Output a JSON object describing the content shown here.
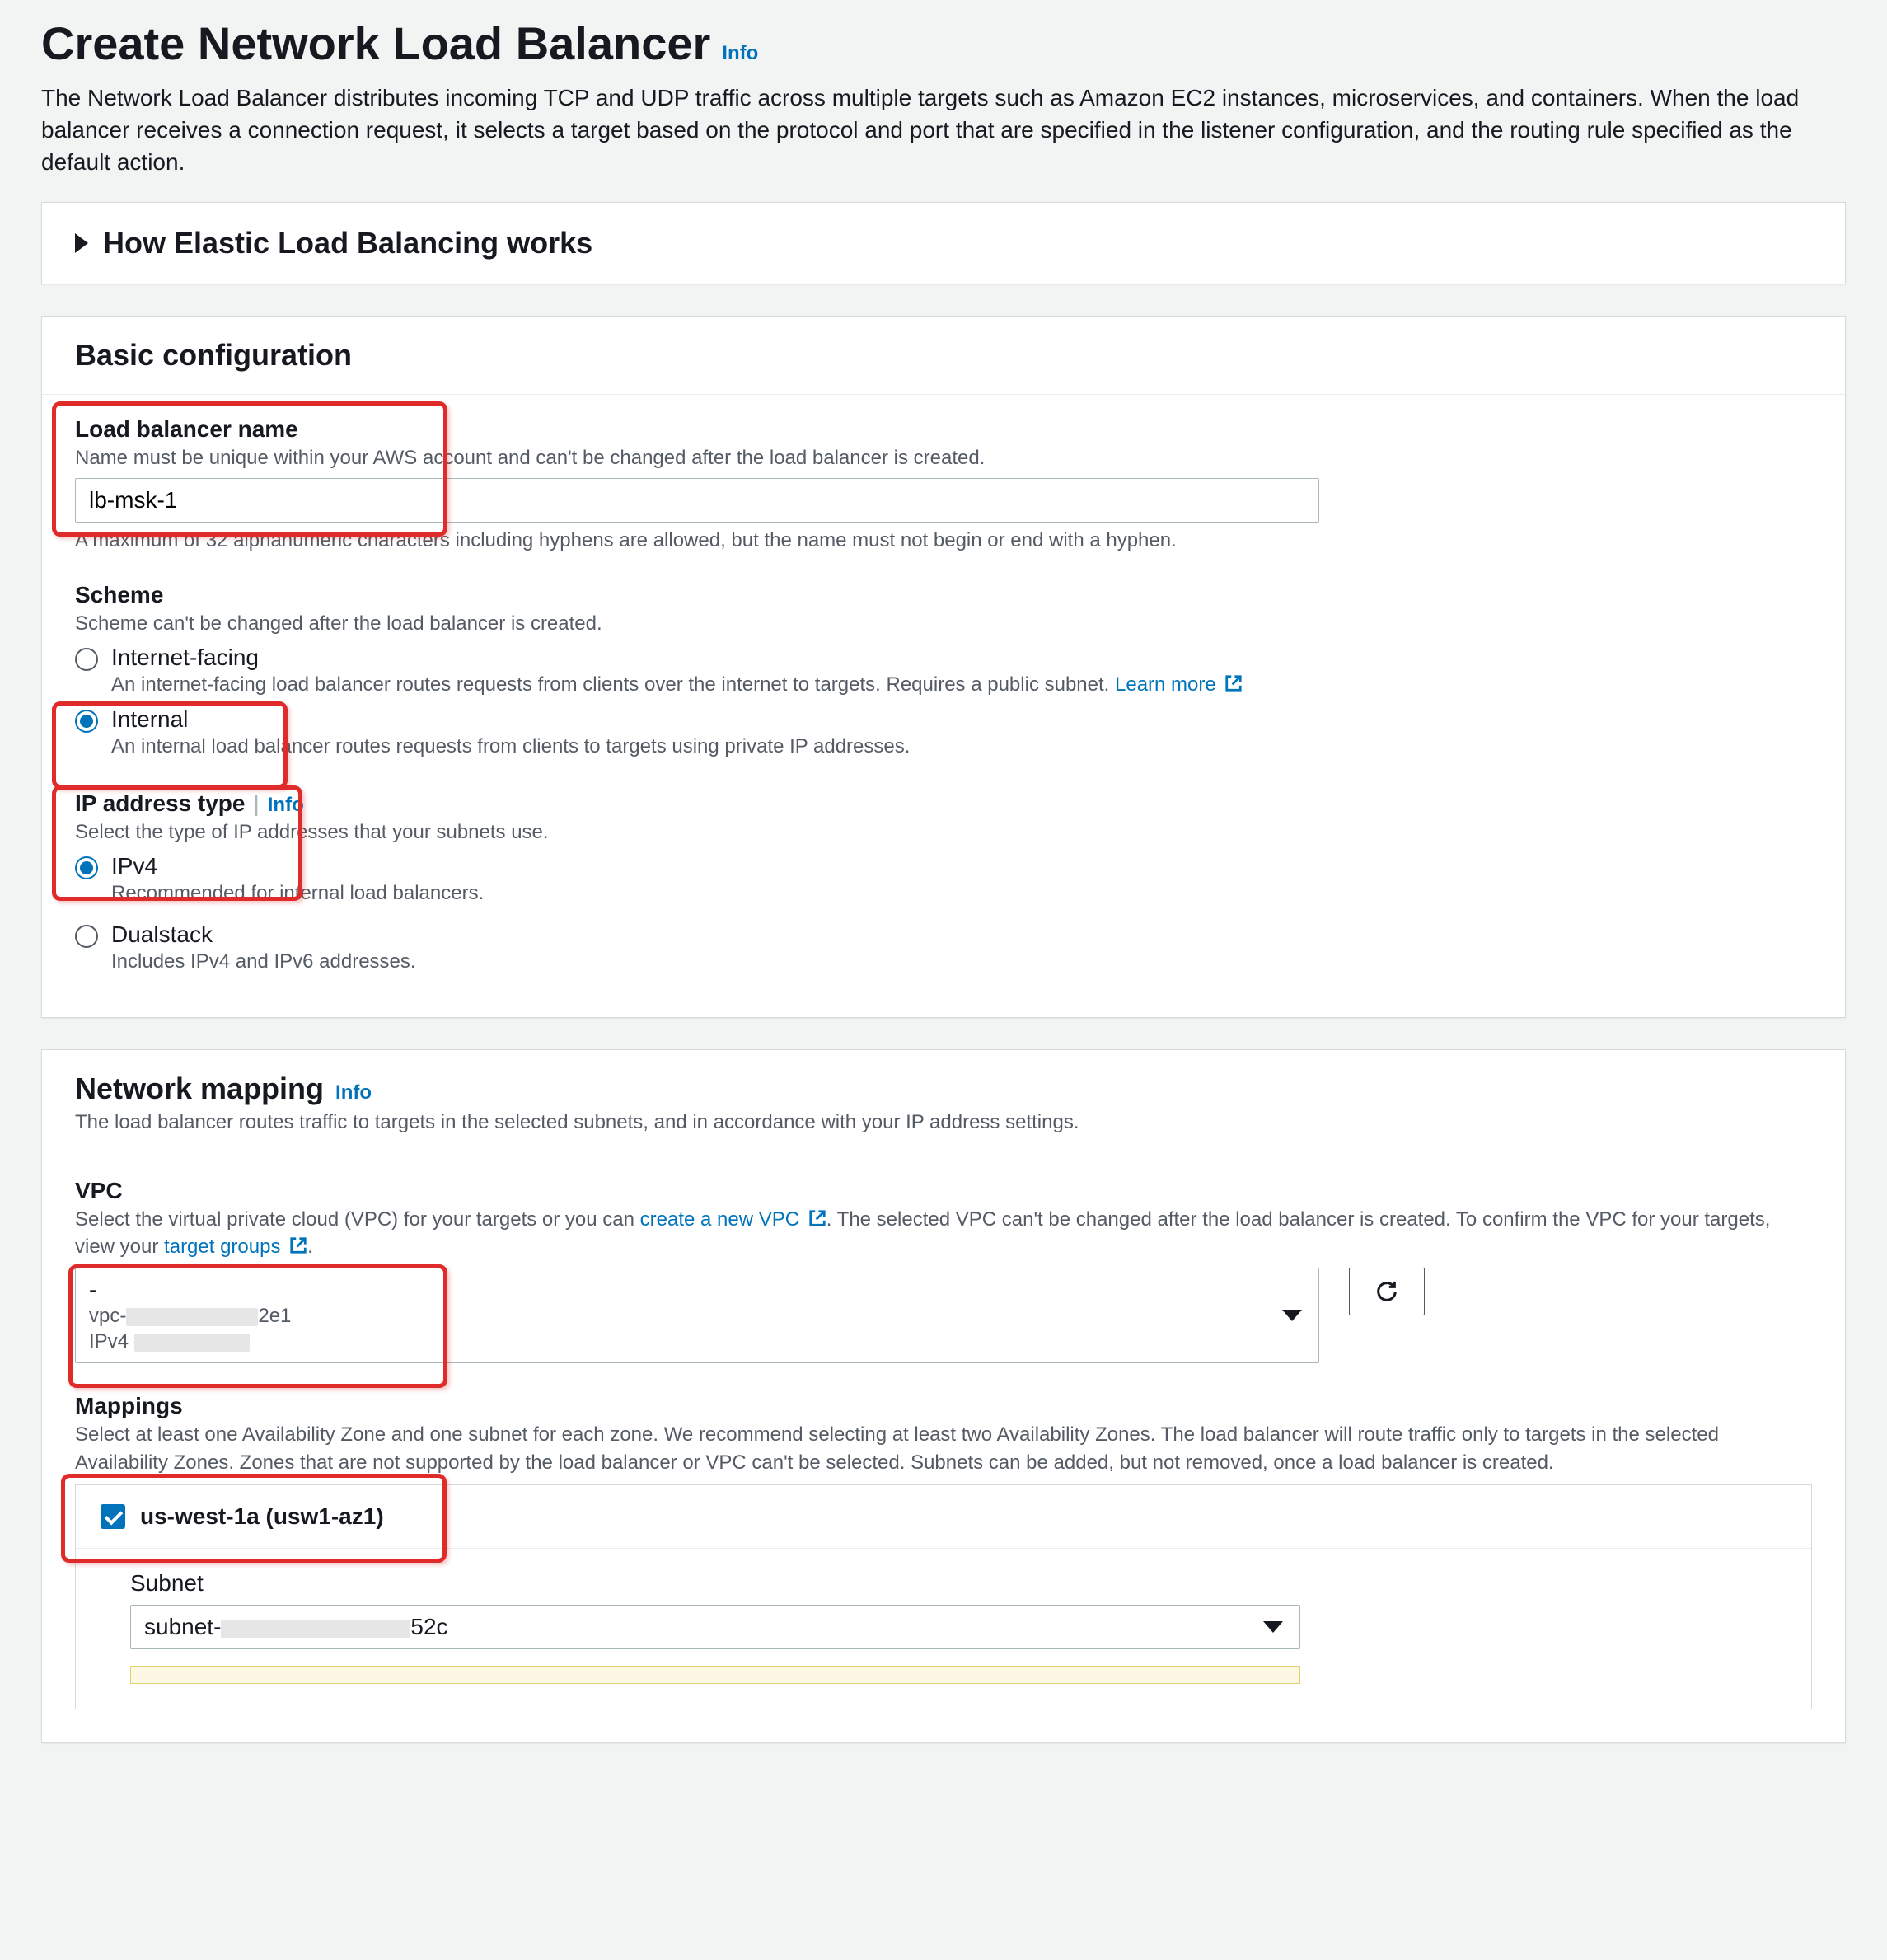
{
  "page": {
    "title": "Create Network Load Balancer",
    "info": "Info",
    "description": "The Network Load Balancer distributes incoming TCP and UDP traffic across multiple targets such as Amazon EC2 instances, microservices, and containers. When the load balancer receives a connection request, it selects a target based on the protocol and port that are specified in the listener configuration, and the routing rule specified as the default action."
  },
  "expander": {
    "title": "How Elastic Load Balancing works"
  },
  "basic": {
    "heading": "Basic configuration",
    "name": {
      "label": "Load balancer name",
      "hint": "Name must be unique within your AWS account and can't be changed after the load balancer is created.",
      "value": "lb-msk-1",
      "constraint": "A maximum of 32 alphanumeric characters including hyphens are allowed, but the name must not begin or end with a hyphen."
    },
    "scheme": {
      "label": "Scheme",
      "hint": "Scheme can't be changed after the load balancer is created.",
      "options": [
        {
          "label": "Internet-facing",
          "desc_prefix": "An internet-facing load balancer routes requests from clients over the internet to targets. Requires a public subnet. ",
          "learn_more": "Learn more",
          "checked": false
        },
        {
          "label": "Internal",
          "desc": "An internal load balancer routes requests from clients to targets using private IP addresses.",
          "checked": true
        }
      ]
    },
    "ip": {
      "label": "IP address type",
      "info": "Info",
      "hint": "Select the type of IP addresses that your subnets use.",
      "options": [
        {
          "label": "IPv4",
          "desc": "Recommended for internal load balancers.",
          "checked": true
        },
        {
          "label": "Dualstack",
          "desc": "Includes IPv4 and IPv6 addresses.",
          "checked": false
        }
      ]
    }
  },
  "network": {
    "heading": "Network mapping",
    "info": "Info",
    "desc": "The load balancer routes traffic to targets in the selected subnets, and in accordance with your IP address settings.",
    "vpc": {
      "label": "VPC",
      "hint_prefix": "Select the virtual private cloud (VPC) for your targets or you can ",
      "create_link": "create a new VPC",
      "hint_mid": ". The selected VPC can't be changed after the load balancer is created. To confirm the VPC for your targets, view your ",
      "target_groups_link": "target groups",
      "hint_suffix": ".",
      "selected": {
        "line1": "-",
        "vpc_prefix": "vpc-",
        "vpc_suffix": "2e1",
        "ipv4_label": "IPv4"
      }
    },
    "mappings": {
      "label": "Mappings",
      "hint": "Select at least one Availability Zone and one subnet for each zone. We recommend selecting at least two Availability Zones. The load balancer will route traffic only to targets in the selected Availability Zones. Zones that are not supported by the load balancer or VPC can't be selected. Subnets can be added, but not removed, once a load balancer is created.",
      "az": {
        "label": "us-west-1a (usw1-az1)",
        "checked": true,
        "subnet_label": "Subnet",
        "subnet_prefix": "subnet-",
        "subnet_suffix": "52c"
      }
    }
  }
}
